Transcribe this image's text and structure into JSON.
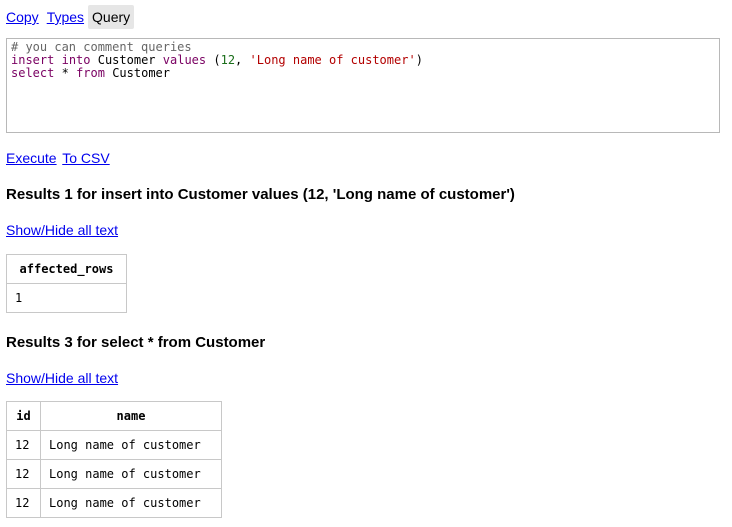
{
  "tabs": [
    {
      "label": "Copy"
    },
    {
      "label": "Types"
    },
    {
      "label": "Query"
    }
  ],
  "editor": {
    "comment": "# you can comment queries",
    "line2": {
      "kw1": "insert",
      "kw2": "into",
      "table": "Customer",
      "kw3": "values",
      "open": "(",
      "num": "12",
      "comma": ",",
      "str": "'Long name of customer'",
      "close": ")"
    },
    "line3": {
      "kw1": "select",
      "star": "*",
      "kw2": "from",
      "table": "Customer"
    }
  },
  "actions": {
    "execute": "Execute",
    "to_csv": "To CSV"
  },
  "results": [
    {
      "title": "Results 1 for insert into Customer values (12, 'Long name of customer')",
      "toggle": "Show/Hide all text",
      "columns": [
        "affected_rows"
      ],
      "rows": [
        [
          "1"
        ]
      ]
    },
    {
      "title": "Results 3 for select * from Customer",
      "toggle": "Show/Hide all text",
      "columns": [
        "id",
        "name"
      ],
      "rows": [
        [
          "12",
          "Long name of customer"
        ],
        [
          "12",
          "Long name of customer"
        ],
        [
          "12",
          "Long name of customer"
        ]
      ]
    }
  ]
}
